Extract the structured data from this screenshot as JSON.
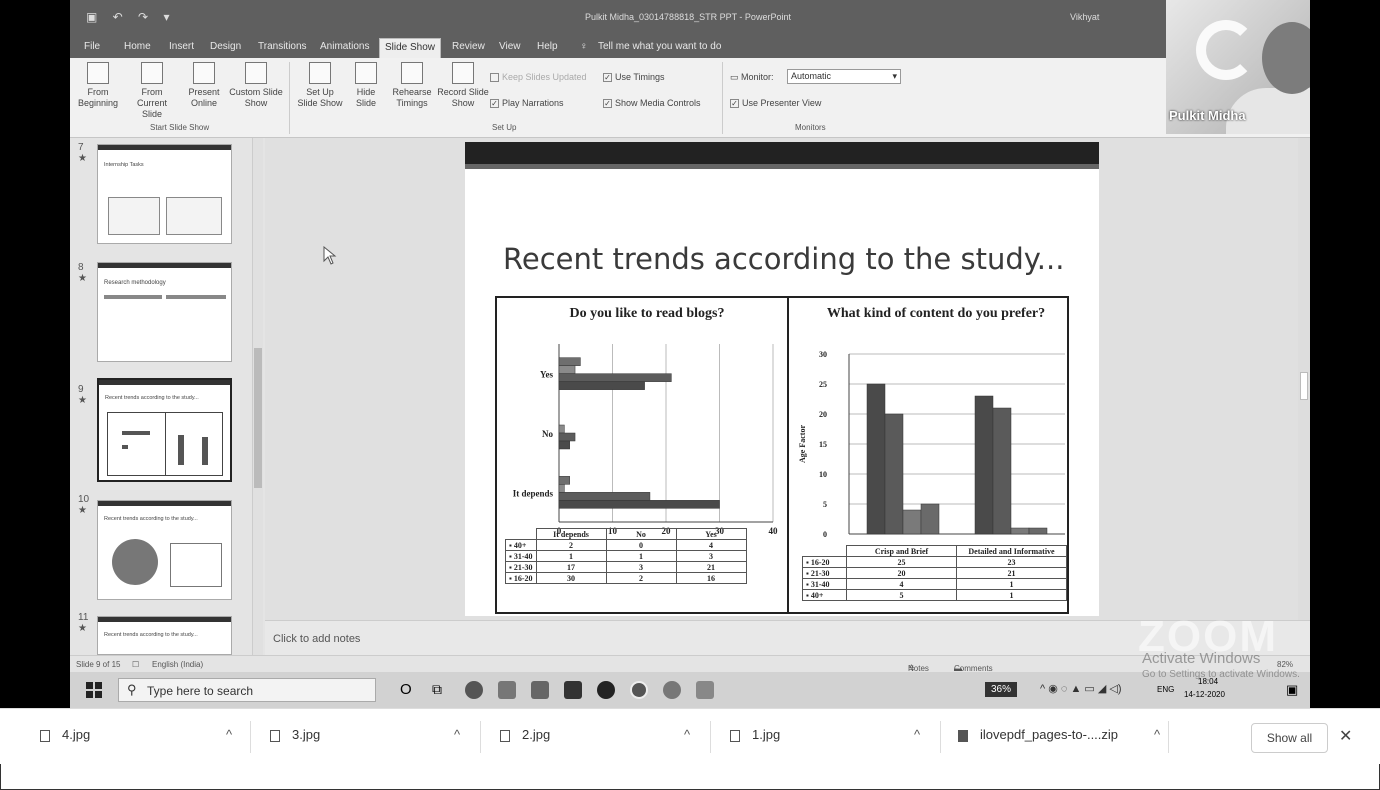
{
  "window": {
    "title": "Pulkit Midha_03014788818_STR PPT  -  PowerPoint",
    "user_short": "Vikhyat"
  },
  "ribbon_tabs": [
    "File",
    "Home",
    "Insert",
    "Design",
    "Transitions",
    "Animations",
    "Slide Show",
    "Review",
    "View",
    "Help",
    "Tell me what you want to do"
  ],
  "ribbon": {
    "from_beginning": "From Beginning",
    "from_current": "From Current Slide",
    "present_online": "Present Online",
    "custom_show": "Custom Slide Show",
    "group_start": "Start Slide Show",
    "set_up": "Set Up Slide Show",
    "hide_slide": "Hide Slide",
    "rehearse": "Rehearse Timings",
    "record": "Record Slide Show",
    "keep_updated": "Keep Slides Updated",
    "play_narrations": "Play Narrations",
    "use_timings": "Use Timings",
    "show_media": "Show Media Controls",
    "group_setup": "Set Up",
    "monitor_label": "Monitor:",
    "monitor_value": "Automatic",
    "presenter_view": "Use Presenter View",
    "group_monitors": "Monitors"
  },
  "thumbnails": [
    {
      "num": "7",
      "star": "★",
      "title": "Internship Tasks"
    },
    {
      "num": "8",
      "star": "★",
      "title": "Research methodology"
    },
    {
      "num": "9",
      "star": "★",
      "title": "Recent trends according to the study..."
    },
    {
      "num": "10",
      "star": "★",
      "title": "Recent trends according to the study..."
    },
    {
      "num": "11",
      "star": "★",
      "title": "Recent trends according to the study..."
    }
  ],
  "slide": {
    "title": "Recent trends according to the study..."
  },
  "chart_data": [
    {
      "type": "bar",
      "orientation": "horizontal",
      "title": "Do you like to read blogs?",
      "categories": [
        "It depends",
        "No",
        "Yes"
      ],
      "xlim": [
        0,
        40
      ],
      "xticks": [
        "0",
        "10",
        "20",
        "30",
        "40"
      ],
      "series": [
        {
          "name": "40+",
          "values": [
            2,
            0,
            4
          ],
          "color": "#6e6e6e"
        },
        {
          "name": "31-40",
          "values": [
            1,
            1,
            3
          ],
          "color": "#8a8a8a"
        },
        {
          "name": "21-30",
          "values": [
            17,
            3,
            21
          ],
          "color": "#5c5c5c"
        },
        {
          "name": "16-20",
          "values": [
            30,
            2,
            16
          ],
          "color": "#4a4a4a"
        }
      ],
      "table_header": [
        "It depends",
        "No",
        "Yes"
      ],
      "table_rows": [
        {
          "label": "40+",
          "cells": [
            "2",
            "0",
            "4"
          ]
        },
        {
          "label": "31-40",
          "cells": [
            "1",
            "1",
            "3"
          ]
        },
        {
          "label": "21-30",
          "cells": [
            "17",
            "3",
            "21"
          ]
        },
        {
          "label": "16-20",
          "cells": [
            "30",
            "2",
            "16"
          ]
        }
      ]
    },
    {
      "type": "bar",
      "title": "What kind of content do you prefer?",
      "ylabel": "Age Factor",
      "categories": [
        "Crisp and Brief",
        "Detailed and Informative"
      ],
      "ylim": [
        0,
        30
      ],
      "yticks": [
        "0",
        "5",
        "10",
        "15",
        "20",
        "25",
        "30"
      ],
      "series": [
        {
          "name": "16-20",
          "values": [
            25,
            23
          ],
          "color": "#4a4a4a"
        },
        {
          "name": "21-30",
          "values": [
            20,
            21
          ],
          "color": "#5a5a5a"
        },
        {
          "name": "31-40",
          "values": [
            4,
            1
          ],
          "color": "#7a7a7a"
        },
        {
          "name": "40+",
          "values": [
            5,
            1
          ],
          "color": "#6a6a6a"
        }
      ],
      "table_rows": [
        {
          "label": "16-20",
          "cells": [
            "25",
            "23"
          ]
        },
        {
          "label": "21-30",
          "cells": [
            "20",
            "21"
          ]
        },
        {
          "label": "31-40",
          "cells": [
            "4",
            "1"
          ]
        },
        {
          "label": "40+",
          "cells": [
            "5",
            "1"
          ]
        }
      ]
    }
  ],
  "notes_placeholder": "Click to add notes",
  "status": {
    "slide_of": "Slide 9 of 15",
    "language": "English (India)",
    "notes": "Notes",
    "comments": "Comments",
    "zoom": "82%"
  },
  "taskbar": {
    "search_placeholder": "Type here to search",
    "battery": "36%",
    "lang": "ENG",
    "time": "18:04",
    "date": "14-12-2020"
  },
  "webcam": {
    "name": "Pulkit Midha"
  },
  "overlay": {
    "zoom_logo": "ZOOM",
    "activate": "Activate Windows",
    "activate_sub": "Go to Settings to activate Windows."
  },
  "downloads": [
    {
      "name": "4.jpg"
    },
    {
      "name": "3.jpg"
    },
    {
      "name": "2.jpg"
    },
    {
      "name": "1.jpg"
    },
    {
      "name": "ilovepdf_pages-to-....zip"
    }
  ],
  "download_bar": {
    "show_all": "Show all",
    "close": "✕",
    "caret": "^"
  }
}
